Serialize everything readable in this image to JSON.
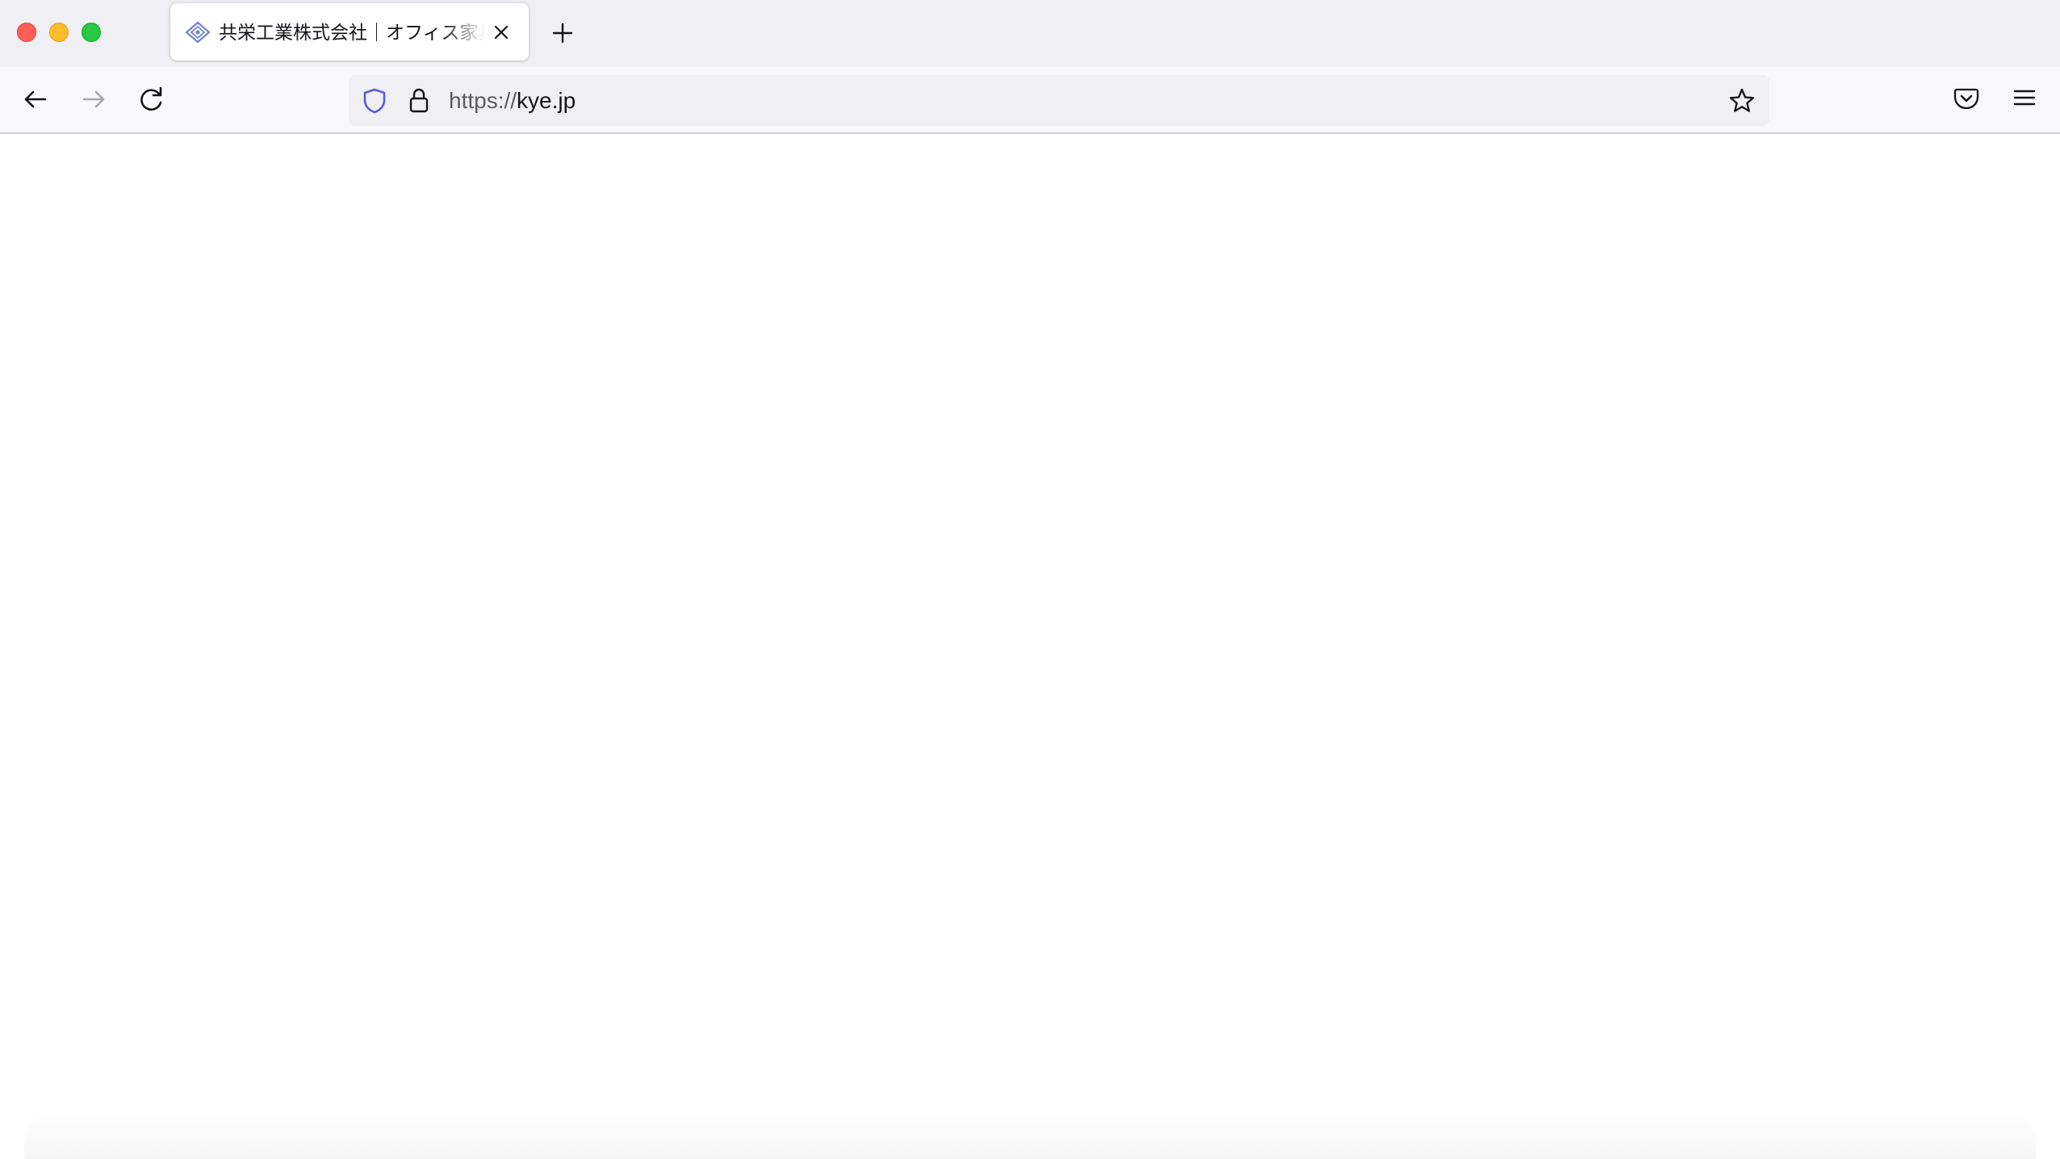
{
  "browser": {
    "tab": {
      "title": "共栄工業株式会社｜オフィス家具",
      "favicon": "kyoei-diamond-logo-icon"
    },
    "url": {
      "scheme": "https://",
      "host": "kye.jp"
    },
    "colors": {
      "tabstrip": "#f0f0f4",
      "toolbar": "#f9f9fb",
      "urlbar": "#f0f0f4",
      "shield_accent": "#5b5bd6",
      "traffic_close": "#ff5f57",
      "traffic_minimize": "#febc2e",
      "traffic_maximize": "#28c840"
    },
    "icons": {
      "back": "arrow-left-icon",
      "forward": "arrow-right-icon",
      "reload": "reload-icon",
      "tracking_protection": "shield-icon",
      "connection": "lock-icon",
      "bookmark": "star-icon",
      "pocket": "pocket-icon",
      "menu": "hamburger-menu-icon",
      "new_tab": "plus-icon",
      "close_tab": "close-icon"
    }
  }
}
